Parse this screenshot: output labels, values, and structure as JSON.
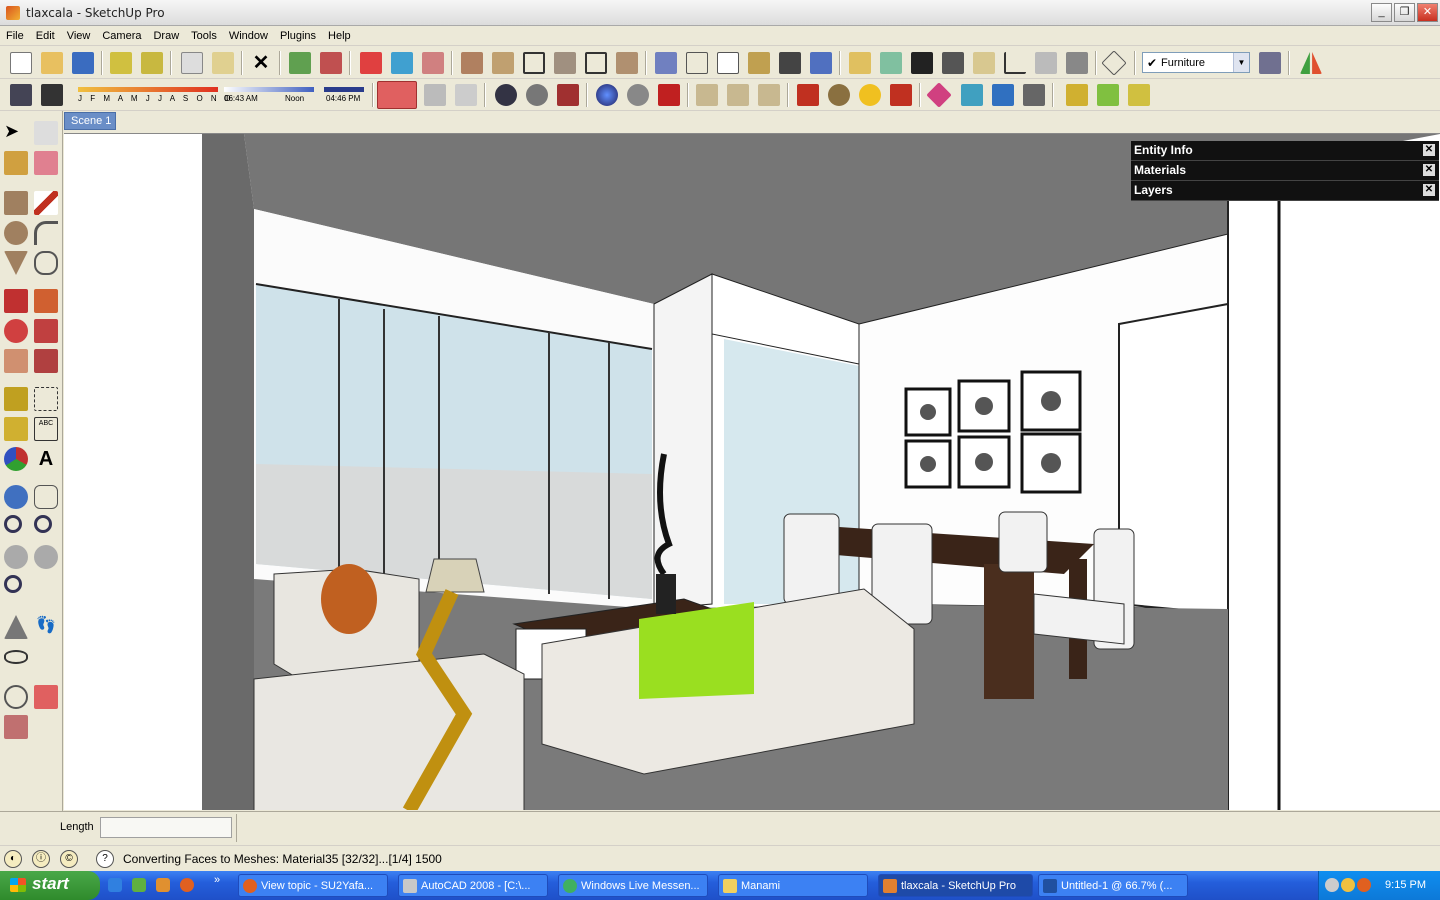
{
  "window": {
    "title": "tlaxcala - SketchUp Pro",
    "buttons": [
      "_",
      "❐",
      "✕"
    ]
  },
  "menu": [
    "File",
    "Edit",
    "View",
    "Camera",
    "Draw",
    "Tools",
    "Window",
    "Plugins",
    "Help"
  ],
  "layers": {
    "current": "Furniture",
    "checked": true
  },
  "shadows": {
    "months": "J F M A M J J A S O N D",
    "time_start": "06:43 AM",
    "time_mid": "Noon",
    "time_end": "04:46 PM"
  },
  "scene": {
    "tab": "Scene 1"
  },
  "trays": [
    {
      "label": "Entity Info"
    },
    {
      "label": "Materials"
    },
    {
      "label": "Layers"
    }
  ],
  "vcb": {
    "label": "Length",
    "value": ""
  },
  "status": {
    "message": "Converting Faces to Meshes: Material35 [32/32]...[1/4] 1500"
  },
  "taskbar": {
    "start": "start",
    "tasks": [
      {
        "label": "View topic - SU2Yafa..."
      },
      {
        "label": "AutoCAD 2008 - [C:\\..."
      },
      {
        "label": "Windows Live Messen..."
      },
      {
        "label": "Manami"
      },
      {
        "label": "tlaxcala - SketchUp Pro"
      },
      {
        "label": "Untitled-1 @ 66.7% (..."
      }
    ],
    "clock": "9:15 PM"
  },
  "colors": {
    "taskbar_blue": "#245edb",
    "scene_tab": "#6a8ec7",
    "tray_dark": "#111111"
  }
}
